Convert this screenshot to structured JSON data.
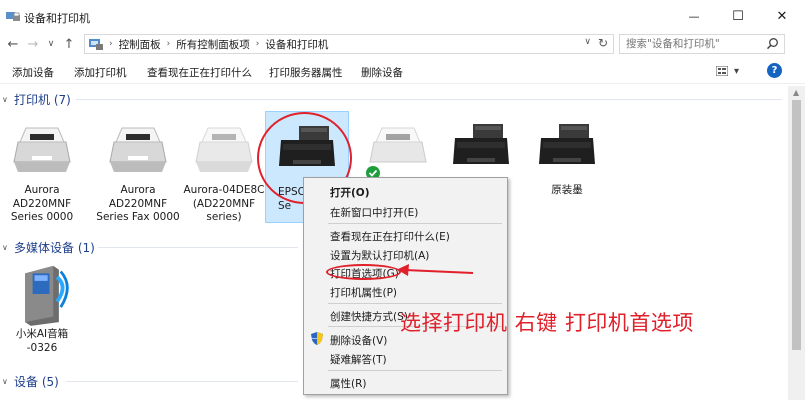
{
  "window": {
    "title": "设备和打印机",
    "min_glyph": "—",
    "max_glyph": "☐",
    "close_glyph": "✕"
  },
  "nav": {
    "back": "←",
    "forward": "→",
    "recent": "∨",
    "up": "↑"
  },
  "address": {
    "crumbs": [
      "控制面板",
      "所有控制面板项",
      "设备和打印机"
    ],
    "sep": "›",
    "dropdown": "∨",
    "refresh": "↻"
  },
  "search": {
    "placeholder": "搜索\"设备和打印机\"",
    "icon": "search-icon"
  },
  "commands": [
    "添加设备",
    "添加打印机",
    "查看现在正在打印什么",
    "打印服务器属性",
    "删除设备"
  ],
  "view_dd": "▾",
  "help_glyph": "?",
  "groups": {
    "printers": "打印机 (7)",
    "multimedia": "多媒体设备 (1)",
    "devices": "设备 (5)",
    "chev_open": "∨"
  },
  "printers": [
    {
      "caption": "Aurora\nAD220MNF\nSeries 0000",
      "style": "mfp"
    },
    {
      "caption": "Aurora\nAD220MNF\nSeries Fax 0000",
      "style": "mfp"
    },
    {
      "caption": "Aurora-04DE8C\n(AD220MNF\nseries)",
      "style": "mfp-gray"
    },
    {
      "caption": "EPSO\nSe",
      "style": "epson"
    },
    {
      "caption": "",
      "style": "mfp-default"
    },
    {
      "caption": "",
      "style": "epson"
    },
    {
      "caption": "原装墨",
      "style": "epson"
    }
  ],
  "media": [
    {
      "caption": "小米AI音箱\n-0326"
    }
  ],
  "context_menu": {
    "items": [
      {
        "label": "打开(O)",
        "bold": true
      },
      {
        "label": "在新窗口中打开(E)"
      },
      {
        "label": "查看现在正在打印什么(E)"
      },
      {
        "label": "设置为默认打印机(A)"
      },
      {
        "label": "打印首选项(G)"
      },
      {
        "label": "打印机属性(P)"
      },
      {
        "label": "创建快捷方式(S)"
      },
      {
        "label": "删除设备(V)"
      },
      {
        "label": "疑难解答(T)"
      },
      {
        "label": "属性(R)"
      }
    ]
  },
  "annotation": "选择打印机 右键 打印机首选项",
  "colors": {
    "accent_red": "#e0202a",
    "group_blue": "#1e3f8a",
    "selection": "#cce8ff",
    "help_blue": "#1565c0"
  }
}
